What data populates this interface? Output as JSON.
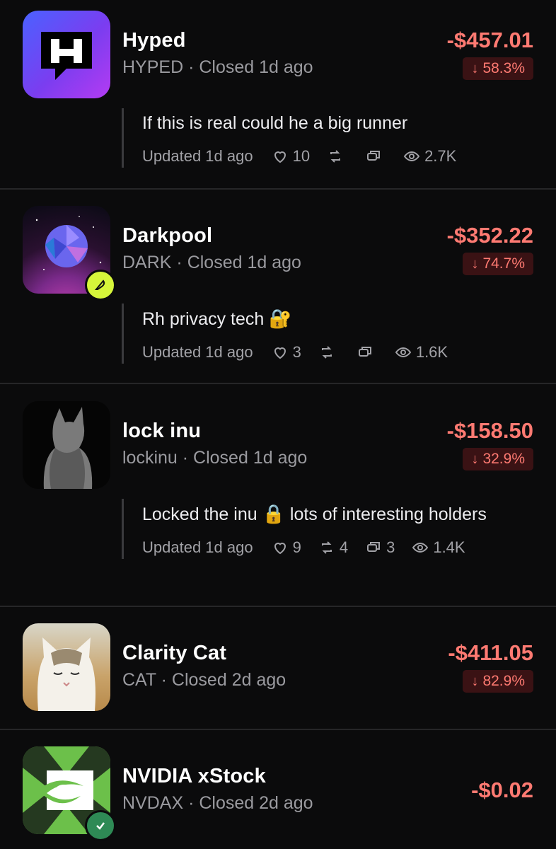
{
  "accent": {
    "loss": "#ff7a72",
    "loss_bg": "#3a1214",
    "muted": "#9a9a9f"
  },
  "items": [
    {
      "name": "Hyped",
      "ticker": "HYPED",
      "closed": "Closed 1d ago",
      "pnl": "-$457.01",
      "change": "58.3%",
      "avatar": "hyped-logo",
      "comment": "If this is real could he a big runner",
      "comment_emoji": "",
      "updated": "Updated 1d ago",
      "likes": "10",
      "reposts": "",
      "replies": "",
      "views": "2.7K"
    },
    {
      "name": "Darkpool",
      "ticker": "DARK",
      "closed": "Closed 1d ago",
      "pnl": "-$352.22",
      "change": "74.7%",
      "avatar": "darkpool-orb",
      "badge": "feather-badge",
      "comment": "Rh privacy tech",
      "comment_emoji": "🔐",
      "updated": "Updated 1d ago",
      "likes": "3",
      "reposts": "",
      "replies": "",
      "views": "1.6K"
    },
    {
      "name": "lock inu",
      "ticker": "lockinu",
      "closed": "Closed 1d ago",
      "pnl": "-$158.50",
      "change": "32.9%",
      "avatar": "lock-inu-cat",
      "comment": "Locked the inu",
      "comment_emoji": "🔒",
      "comment_tail": "lots of interesting holders",
      "updated": "Updated 1d ago",
      "likes": "9",
      "reposts": "4",
      "replies": "3",
      "views": "1.4K"
    },
    {
      "name": "Clarity Cat",
      "ticker": "CAT",
      "closed": "Closed 2d ago",
      "pnl": "-$411.05",
      "change": "82.9%",
      "avatar": "clarity-cat"
    },
    {
      "name": "NVIDIA xStock",
      "ticker": "NVDAX",
      "closed": "Closed 2d ago",
      "pnl": "-$0.02",
      "avatar": "nvidia-logo",
      "badge": "verified-badge"
    }
  ]
}
